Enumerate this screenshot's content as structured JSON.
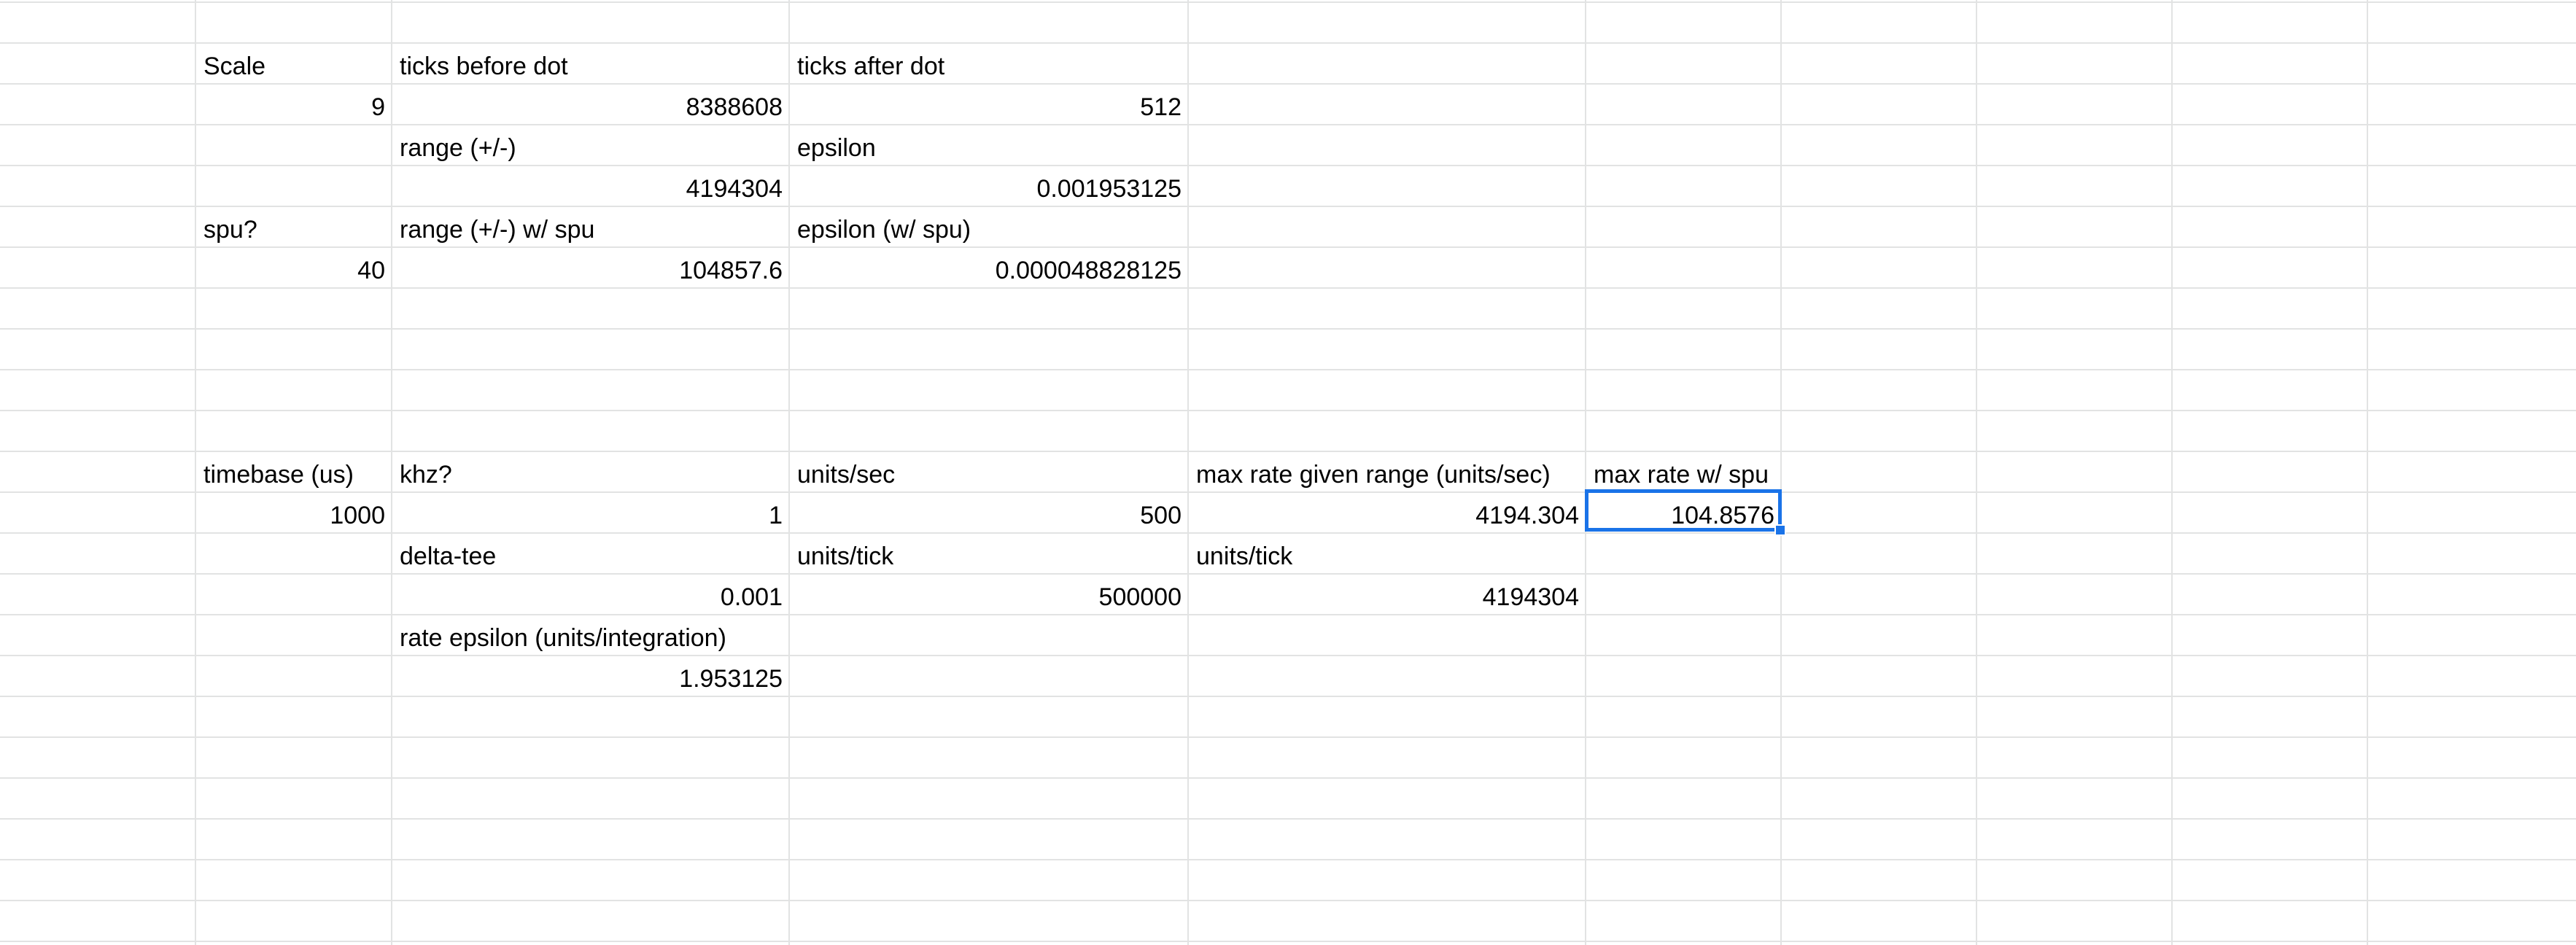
{
  "cells": [
    {
      "id": "B2",
      "text": "Scale",
      "kind": "label"
    },
    {
      "id": "C2",
      "text": "ticks before dot",
      "kind": "label"
    },
    {
      "id": "D2",
      "text": "ticks after dot",
      "kind": "label"
    },
    {
      "id": "B3",
      "text": "9",
      "kind": "number"
    },
    {
      "id": "C3",
      "text": "8388608",
      "kind": "number"
    },
    {
      "id": "D3",
      "text": "512",
      "kind": "number"
    },
    {
      "id": "C4",
      "text": "range (+/-)",
      "kind": "label"
    },
    {
      "id": "D4",
      "text": "epsilon",
      "kind": "label"
    },
    {
      "id": "C5",
      "text": "4194304",
      "kind": "number"
    },
    {
      "id": "D5",
      "text": "0.001953125",
      "kind": "number"
    },
    {
      "id": "B6",
      "text": "spu?",
      "kind": "label"
    },
    {
      "id": "C6",
      "text": "range (+/-) w/ spu",
      "kind": "label"
    },
    {
      "id": "D6",
      "text": "epsilon (w/ spu)",
      "kind": "label"
    },
    {
      "id": "B7",
      "text": "40",
      "kind": "number"
    },
    {
      "id": "C7",
      "text": "104857.6",
      "kind": "number"
    },
    {
      "id": "D7",
      "text": "0.000048828125",
      "kind": "number"
    },
    {
      "id": "B12",
      "text": "timebase (us)",
      "kind": "label"
    },
    {
      "id": "C12",
      "text": "khz?",
      "kind": "label"
    },
    {
      "id": "D12",
      "text": "units/sec",
      "kind": "label"
    },
    {
      "id": "E12",
      "text": "max rate given range (units/sec)",
      "kind": "label"
    },
    {
      "id": "F12",
      "text": "max rate w/ spu",
      "kind": "label"
    },
    {
      "id": "B13",
      "text": "1000",
      "kind": "number"
    },
    {
      "id": "C13",
      "text": "1",
      "kind": "number"
    },
    {
      "id": "D13",
      "text": "500",
      "kind": "number"
    },
    {
      "id": "E13",
      "text": "4194.304",
      "kind": "number"
    },
    {
      "id": "F13",
      "text": "104.8576",
      "kind": "number",
      "selected": true
    },
    {
      "id": "C14",
      "text": "delta-tee",
      "kind": "label"
    },
    {
      "id": "D14",
      "text": "units/tick",
      "kind": "label"
    },
    {
      "id": "E14",
      "text": "units/tick",
      "kind": "label"
    },
    {
      "id": "C15",
      "text": "0.001",
      "kind": "number"
    },
    {
      "id": "D15",
      "text": "500000",
      "kind": "number"
    },
    {
      "id": "E15",
      "text": "4194304",
      "kind": "number"
    },
    {
      "id": "C16",
      "text": "rate epsilon (units/integration)",
      "kind": "label"
    },
    {
      "id": "C17",
      "text": "1.953125",
      "kind": "number"
    }
  ],
  "selected_cell": "F13",
  "colors": {
    "gridline": "#e2e3e3",
    "selection": "#1a73e8",
    "text": "#000000"
  }
}
